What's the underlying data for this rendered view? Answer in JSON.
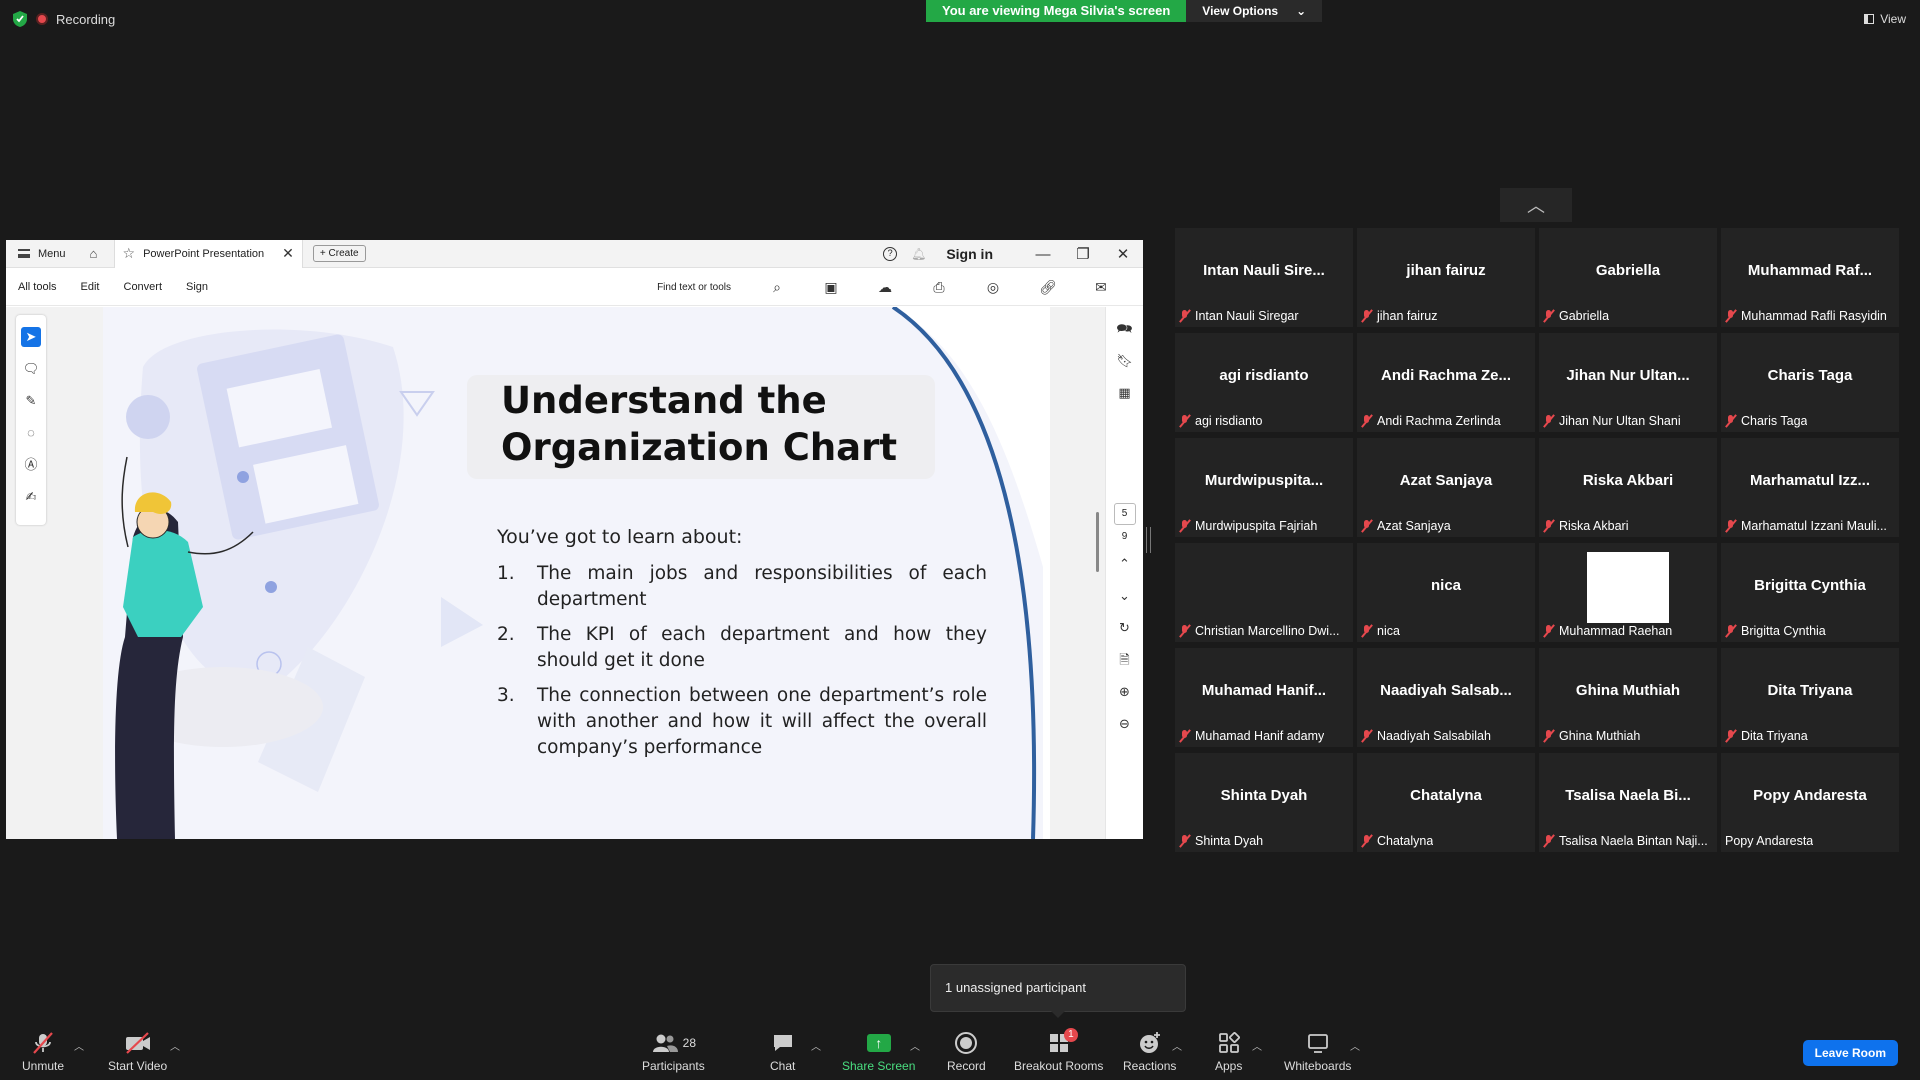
{
  "top": {
    "recording": "Recording",
    "viewing": "You are viewing Mega Silvia's screen",
    "view_options": "View Options",
    "view": "View"
  },
  "acrobat": {
    "menu": "Menu",
    "tab_title": "PowerPoint Presentation",
    "create": "Create",
    "sign_in": "Sign in",
    "toolbar": [
      "All tools",
      "Edit",
      "Convert",
      "Sign"
    ],
    "find": "Find text or tools",
    "page_current": "5",
    "page_total": "9"
  },
  "slide": {
    "title_line1": "Understand the",
    "title_line2": "Organization Chart",
    "intro": "You’ve got to learn about:",
    "items": [
      {
        "num": "1.",
        "text": "The main jobs and responsibilities of each department"
      },
      {
        "num": "2.",
        "text": "The KPI of each department and how they should get it done"
      },
      {
        "num": "3.",
        "text": "The connection between one department’s role with another and how it will affect the overall company’s performance"
      }
    ]
  },
  "participants": [
    {
      "name": "Intan Nauli Sire...",
      "label": "Intan Nauli Siregar",
      "muted": true
    },
    {
      "name": "jihan fairuz",
      "label": "jihan fairuz",
      "muted": true
    },
    {
      "name": "Gabriella",
      "label": "Gabriella",
      "muted": true
    },
    {
      "name": "Muhammad Raf...",
      "label": "Muhammad Rafli Rasyidin",
      "muted": true
    },
    {
      "name": "agi risdianto",
      "label": "agi risdianto",
      "muted": true
    },
    {
      "name": "Andi Rachma Ze...",
      "label": "Andi Rachma Zerlinda",
      "muted": true
    },
    {
      "name": "Jihan Nur Ultan...",
      "label": "Jihan Nur Ultan Shani",
      "muted": true
    },
    {
      "name": "Charis Taga",
      "label": "Charis Taga",
      "muted": true
    },
    {
      "name": "Murdwipuspita...",
      "label": "Murdwipuspita Fajriah",
      "muted": true
    },
    {
      "name": "Azat Sanjaya",
      "label": "Azat Sanjaya",
      "muted": true
    },
    {
      "name": "Riska Akbari",
      "label": "Riska Akbari",
      "muted": true
    },
    {
      "name": "Marhamatul Izz...",
      "label": "Marhamatul Izzani Mauli...",
      "muted": true
    },
    {
      "name": "",
      "label": "Christian Marcellino Dwi...",
      "muted": true
    },
    {
      "name": "nica",
      "label": "nica",
      "muted": true
    },
    {
      "name": "",
      "label": "Muhammad Raehan",
      "muted": true,
      "video": true
    },
    {
      "name": "Brigitta Cynthia",
      "label": "Brigitta Cynthia",
      "muted": true
    },
    {
      "name": "Muhamad Hanif...",
      "label": "Muhamad Hanif adamy",
      "muted": true
    },
    {
      "name": "Naadiyah Salsab...",
      "label": "Naadiyah Salsabilah",
      "muted": true
    },
    {
      "name": "Ghina Muthiah",
      "label": "Ghina Muthiah",
      "muted": true
    },
    {
      "name": "Dita Triyana",
      "label": "Dita Triyana",
      "muted": true
    },
    {
      "name": "Shinta Dyah",
      "label": "Shinta Dyah",
      "muted": true
    },
    {
      "name": "Chatalyna",
      "label": "Chatalyna",
      "muted": true
    },
    {
      "name": "Tsalisa Naela Bi...",
      "label": "Tsalisa Naela Bintan Naji...",
      "muted": true
    },
    {
      "name": "Popy Andaresta",
      "label": "Popy Andaresta",
      "muted": false
    }
  ],
  "tooltip": "1 unassigned participant",
  "toolbar": {
    "unmute": "Unmute",
    "start_video": "Start Video",
    "participants": "Participants",
    "participants_count": "28",
    "chat": "Chat",
    "share_screen": "Share Screen",
    "record": "Record",
    "breakout_rooms": "Breakout Rooms",
    "breakout_badge": "1",
    "reactions": "Reactions",
    "apps": "Apps",
    "whiteboards": "Whiteboards",
    "leave_room": "Leave Room"
  },
  "colors": {
    "share_green": "#23a846",
    "leave_blue": "#0e72ed",
    "muted_red": "#e5484d",
    "acrobat_blue": "#1473e6"
  }
}
